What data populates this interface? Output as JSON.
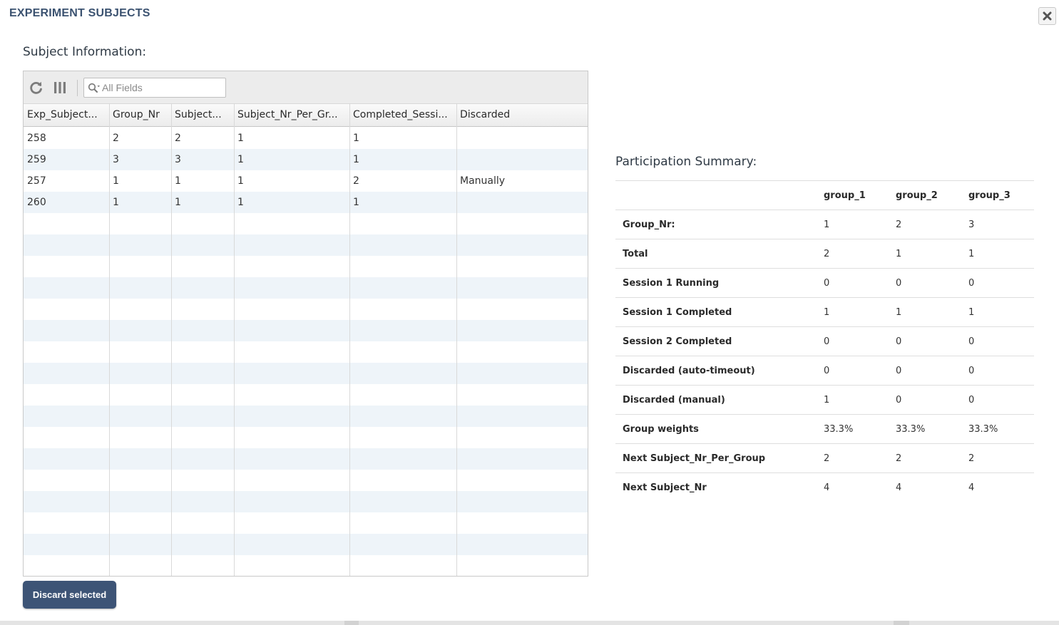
{
  "modal": {
    "title": "EXPERIMENT SUBJECTS",
    "close_icon": "close-icon"
  },
  "subject_info": {
    "title": "Subject Information:",
    "toolbar": {
      "refresh_icon": "refresh-icon",
      "columns_icon": "columns-icon",
      "search_icon": "search-icon",
      "search_placeholder": "All Fields",
      "search_value": ""
    },
    "columns": [
      {
        "key": "exp_subject",
        "label": "Exp_Subject..."
      },
      {
        "key": "group_nr",
        "label": "Group_Nr"
      },
      {
        "key": "subject",
        "label": "Subject..."
      },
      {
        "key": "subject_nr_per_group",
        "label": "Subject_Nr_Per_Gr..."
      },
      {
        "key": "completed_sessions",
        "label": "Completed_Sessi..."
      },
      {
        "key": "discarded",
        "label": "Discarded"
      }
    ],
    "rows": [
      [
        "258",
        "2",
        "2",
        "1",
        "1",
        ""
      ],
      [
        "259",
        "3",
        "3",
        "1",
        "1",
        ""
      ],
      [
        "257",
        "1",
        "1",
        "1",
        "2",
        "Manually"
      ],
      [
        "260",
        "1",
        "1",
        "1",
        "1",
        ""
      ]
    ],
    "discard_button": "Discard selected"
  },
  "participation_summary": {
    "title": "Participation Summary:",
    "headers": [
      "",
      "group_1",
      "group_2",
      "group_3"
    ],
    "rows": [
      {
        "label": "Group_Nr:",
        "values": [
          "1",
          "2",
          "3"
        ]
      },
      {
        "label": "Total",
        "values": [
          "2",
          "1",
          "1"
        ]
      },
      {
        "label": "Session 1 Running",
        "values": [
          "0",
          "0",
          "0"
        ]
      },
      {
        "label": "Session 1 Completed",
        "values": [
          "1",
          "1",
          "1"
        ]
      },
      {
        "label": "Session 2 Completed",
        "values": [
          "0",
          "0",
          "0"
        ]
      },
      {
        "label": "Discarded (auto-timeout)",
        "values": [
          "0",
          "0",
          "0"
        ]
      },
      {
        "label": "Discarded (manual)",
        "values": [
          "1",
          "0",
          "0"
        ]
      },
      {
        "label": "Group weights",
        "values": [
          "33.3%",
          "33.3%",
          "33.3%"
        ]
      },
      {
        "label": "Next Subject_Nr_Per_Group",
        "values": [
          "2",
          "2",
          "2"
        ]
      },
      {
        "label": "Next Subject_Nr",
        "values": [
          "4",
          "4",
          "4"
        ]
      }
    ]
  },
  "colors": {
    "title": "#3b5270",
    "button_bg": "#3d5476",
    "row_alt": "#eef4f9"
  }
}
